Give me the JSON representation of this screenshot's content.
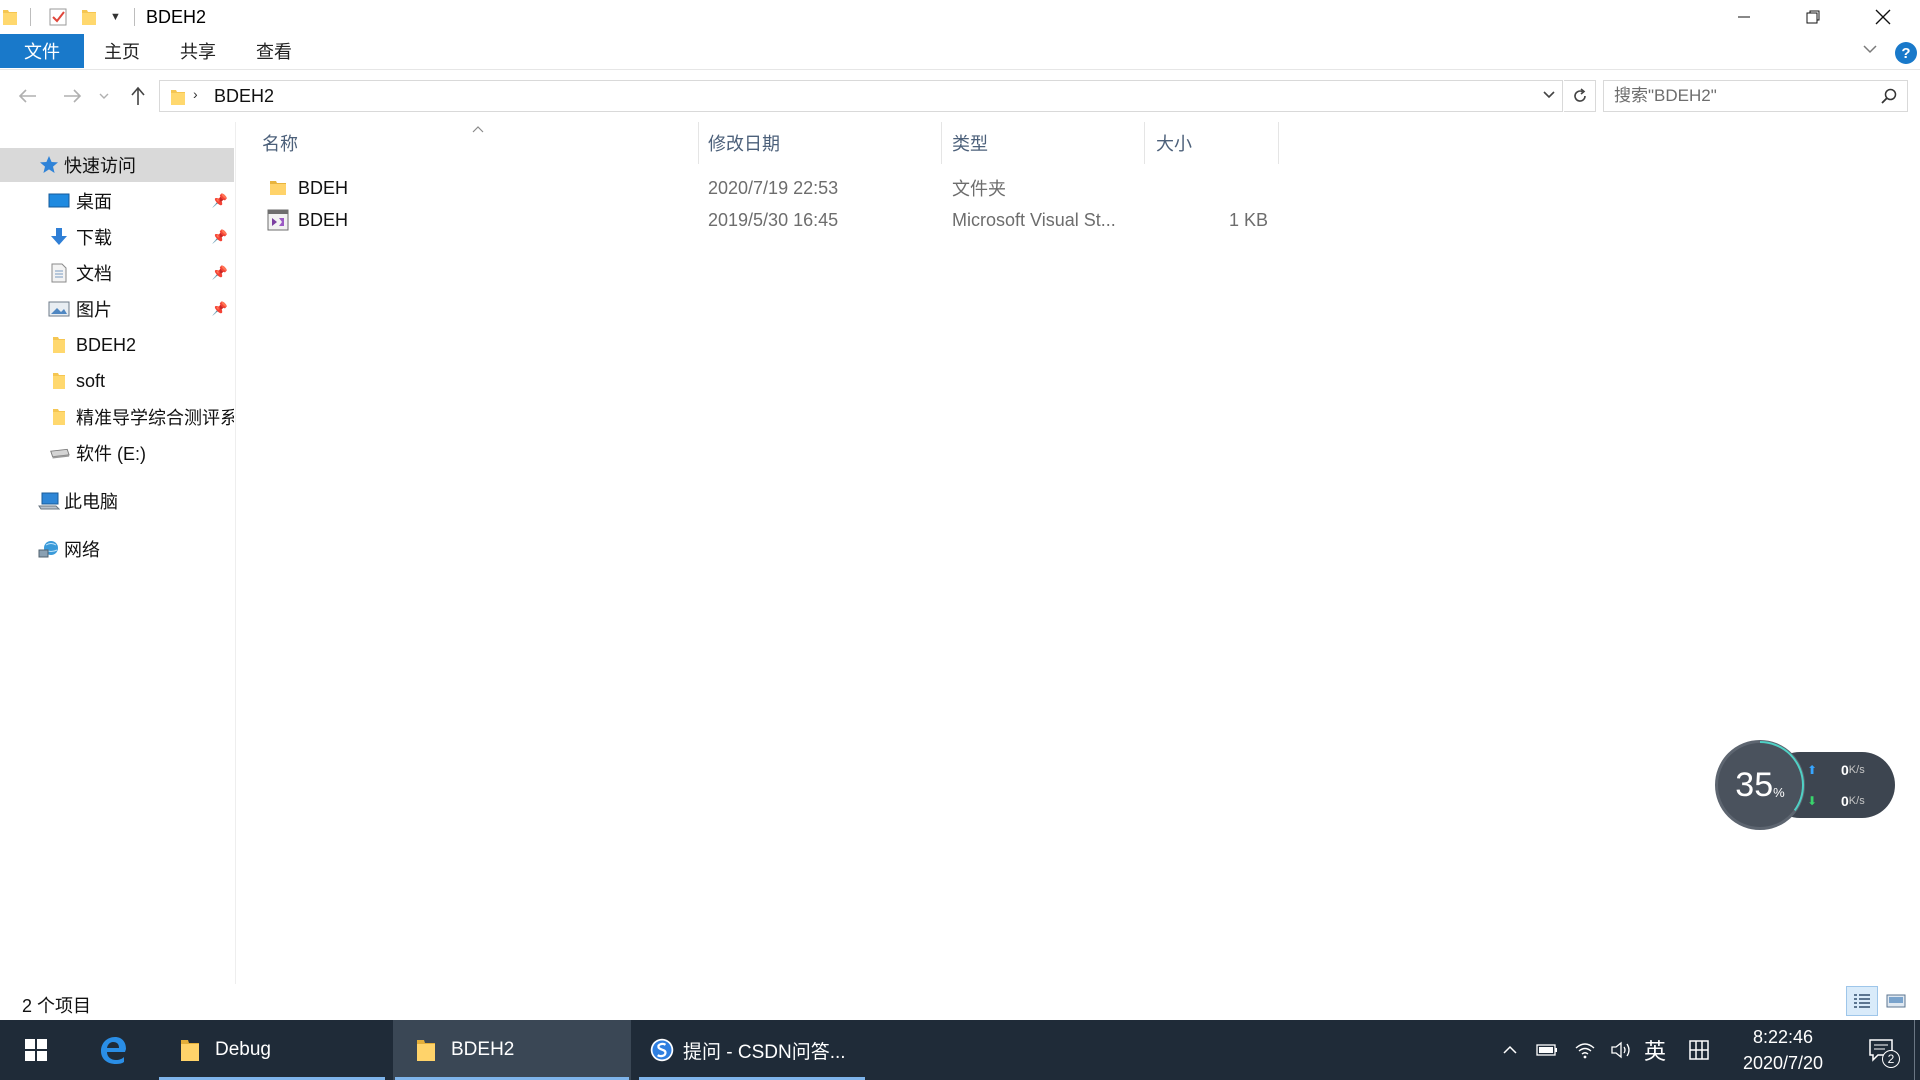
{
  "window": {
    "title": "BDEH2",
    "minimize_icon": "minimize-icon",
    "maximize_icon": "restore-icon",
    "close_icon": "close-icon"
  },
  "ribbon": {
    "tabs": [
      {
        "label": "文件",
        "selected": true
      },
      {
        "label": "主页"
      },
      {
        "label": "共享"
      },
      {
        "label": "查看"
      }
    ],
    "accent": "#1979ca"
  },
  "nav": {
    "address": "BDEH2",
    "search_placeholder": "搜索\"BDEH2\""
  },
  "sidebar": {
    "items": [
      {
        "label": "快速访问",
        "icon": "star-icon",
        "selected": true
      },
      {
        "label": "桌面",
        "icon": "desktop-icon",
        "pinned": true
      },
      {
        "label": "下载",
        "icon": "download-arrow-icon",
        "pinned": true
      },
      {
        "label": "文档",
        "icon": "document-icon",
        "pinned": true
      },
      {
        "label": "图片",
        "icon": "pictures-icon",
        "pinned": true
      },
      {
        "label": "BDEH2",
        "icon": "folder-icon"
      },
      {
        "label": "soft",
        "icon": "folder-icon"
      },
      {
        "label": "精准导学综合测评系",
        "icon": "folder-icon"
      },
      {
        "label": "软件 (E:)",
        "icon": "drive-icon"
      },
      {
        "label": "此电脑",
        "icon": "computer-icon"
      },
      {
        "label": "网络",
        "icon": "network-icon"
      }
    ]
  },
  "list": {
    "columns": [
      "名称",
      "修改日期",
      "类型",
      "大小"
    ],
    "rows": [
      {
        "name": "BDEH",
        "date": "2020/7/19 22:53",
        "type": "文件夹",
        "size": "",
        "icon": "folder-icon"
      },
      {
        "name": "BDEH",
        "date": "2019/5/30 16:45",
        "type": "Microsoft Visual St...",
        "size": "1 KB",
        "icon": "visual-studio-solution-icon"
      }
    ]
  },
  "status": {
    "item_count": "2 个项目"
  },
  "speed_widget": {
    "percent": "35",
    "percent_unit": "%",
    "up_value": "0",
    "down_value": "0",
    "unit": "K/s"
  },
  "taskbar": {
    "apps": [
      {
        "label": "Debug",
        "icon": "folder-icon"
      },
      {
        "label": "BDEH2",
        "icon": "folder-icon",
        "active": true
      },
      {
        "label": "提问 - CSDN问答...",
        "icon": "sogou-browser-icon"
      }
    ],
    "ime": "英",
    "clock_time": "8:22:46",
    "clock_date": "2020/7/20",
    "notification_count": "2"
  }
}
